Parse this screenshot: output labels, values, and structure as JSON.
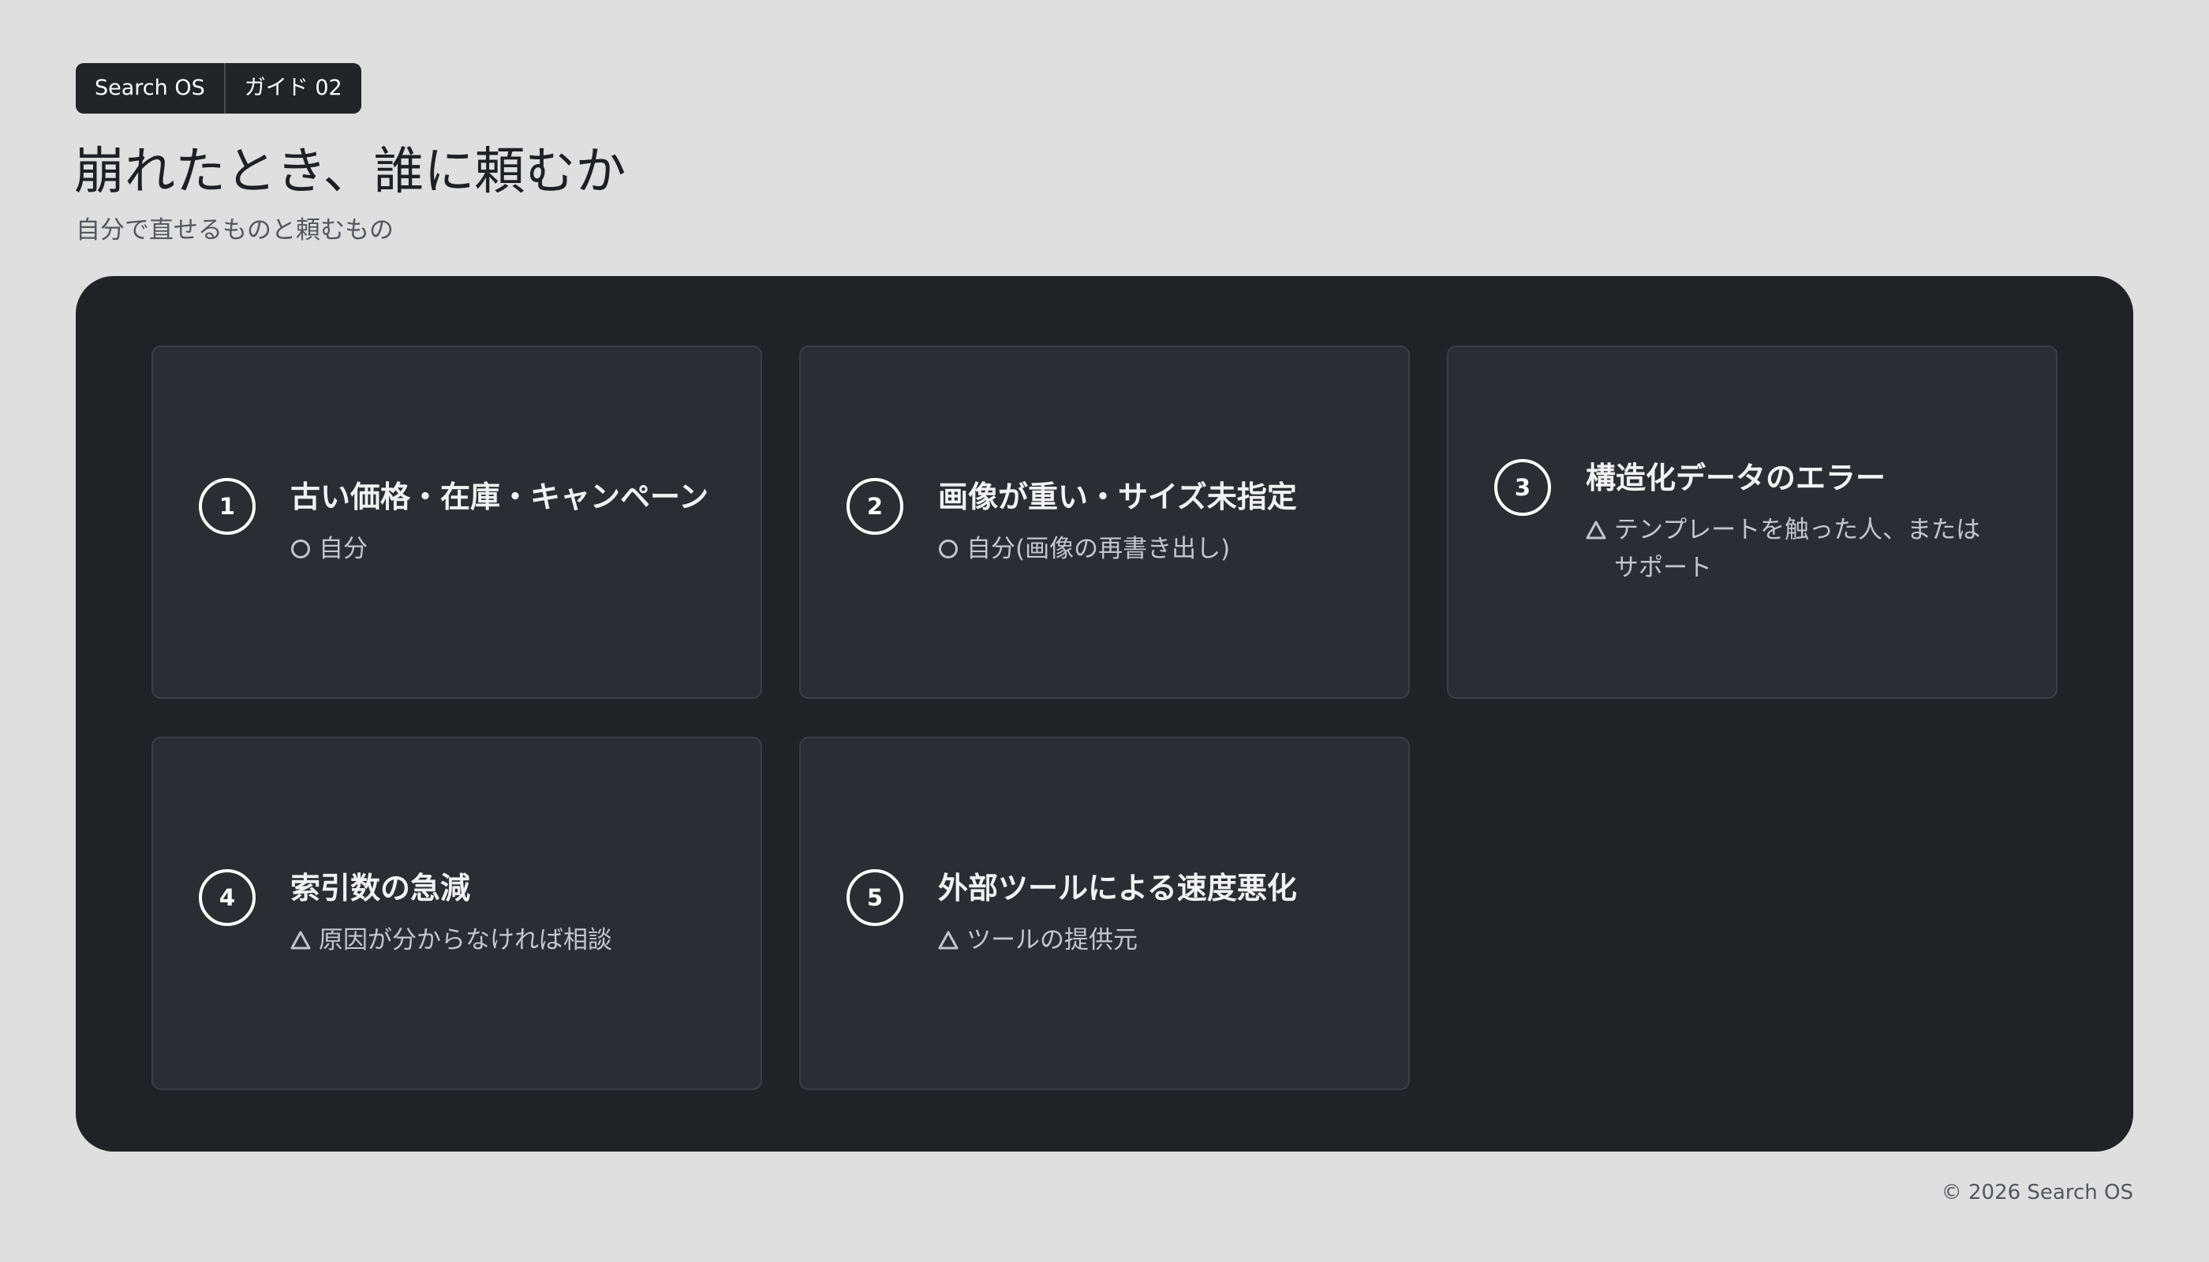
{
  "breadcrumb": {
    "app": "Search OS",
    "section": "ガイド 02"
  },
  "title": "崩れたとき、誰に頼むか",
  "subtitle": "自分で直せるものと頼むもの",
  "cards": [
    {
      "number": "1",
      "title": "古い価格・在庫・キャンペーン",
      "mark_icon": "circle-icon",
      "desc": "自分"
    },
    {
      "number": "2",
      "title": "画像が重い・サイズ未指定",
      "mark_icon": "circle-icon",
      "desc": "自分(画像の再書き出し)"
    },
    {
      "number": "3",
      "title": "構造化データのエラー",
      "mark_icon": "triangle-icon",
      "desc": "テンプレートを触った人、またはサポート"
    },
    {
      "number": "4",
      "title": "索引数の急減",
      "mark_icon": "triangle-icon",
      "desc": "原因が分からなければ相談"
    },
    {
      "number": "5",
      "title": "外部ツールによる速度悪化",
      "mark_icon": "triangle-icon",
      "desc": "ツールの提供元"
    }
  ],
  "footer": "© 2026 Search OS",
  "colors": {
    "background": "#dfdfdf",
    "panel": "#212226",
    "card": "#2b2d32",
    "text_light": "#f2f2f4",
    "text_muted": "#c4c6cc"
  }
}
